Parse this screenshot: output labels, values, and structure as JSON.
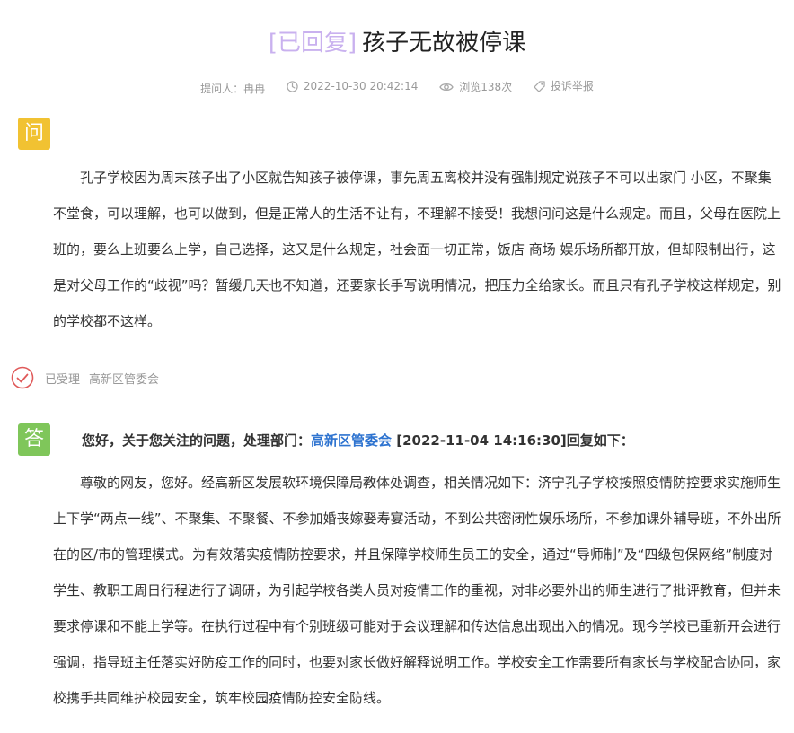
{
  "title": {
    "tag": "[已回复]",
    "text": "孩子无故被停课"
  },
  "meta": {
    "asker": "提问人：冉冉",
    "time": "2022-10-30 20:42:14",
    "views": "浏览138次",
    "report": "投诉举报"
  },
  "question": {
    "badge": "问",
    "text": "孔子学校因为周末孩子出了小区就告知孩子被停课，事先周五离校并没有强制规定说孩子不可以出家门 小区，不聚集 不堂食，可以理解，也可以做到，但是正常人的生活不让有，不理解不接受！我想问问这是什么规定。而且，父母在医院上班的，要么上班要么上学，自己选择，这又是什么规定，社会面一切正常，饭店 商场 娱乐场所都开放，但却限制出行，这是对父母工作的“歧视”吗？暂缓几天也不知道，还要家长手写说明情况，把压力全给家长。而且只有孔子学校这样规定，别的学校都不这样。"
  },
  "status": {
    "label": "已受理",
    "department": "高新区管委会"
  },
  "answer": {
    "badge": "答",
    "head_prefix": "您好，关于您关注的问题，处理部门：",
    "head_department": "高新区管委会",
    "head_suffix": " [2022-11-04 14:16:30]回复如下：",
    "text": "尊敬的网友，您好。经高新区发展软环境保障局教体处调查，相关情况如下：济宁孔子学校按照疫情防控要求实施师生上下学“两点一线”、不聚集、不聚餐、不参加婚丧嫁娶寿宴活动，不到公共密闭性娱乐场所，不参加课外辅导班，不外出所在的区/市的管理模式。为有效落实疫情防控要求，并且保障学校师生员工的安全，通过“导师制”及“四级包保网络”制度对学生、教职工周日行程进行了调研，为引起学校各类人员对疫情工作的重视，对非必要外出的师生进行了批评教育，但并未要求停课和不能上学等。在执行过程中有个别班级可能对于会议理解和传达信息出现出入的情况。现今学校已重新开会进行强调，指导班主任落实好防疫工作的同时，也要对家长做好解释说明工作。学校安全工作需要所有家长与学校配合协同，家校携手共同维护校园安全，筑牢校园疫情防控安全防线。"
  },
  "colors": {
    "tag": "#c9b1ef",
    "question_badge": "#f1c232",
    "answer_badge": "#7fc65a",
    "status_icon": "#e05a5a",
    "link": "#2f74d0"
  },
  "icons": {
    "time": "clock-icon",
    "views": "eye-icon",
    "report": "tag-icon",
    "status": "check-circle-icon"
  }
}
